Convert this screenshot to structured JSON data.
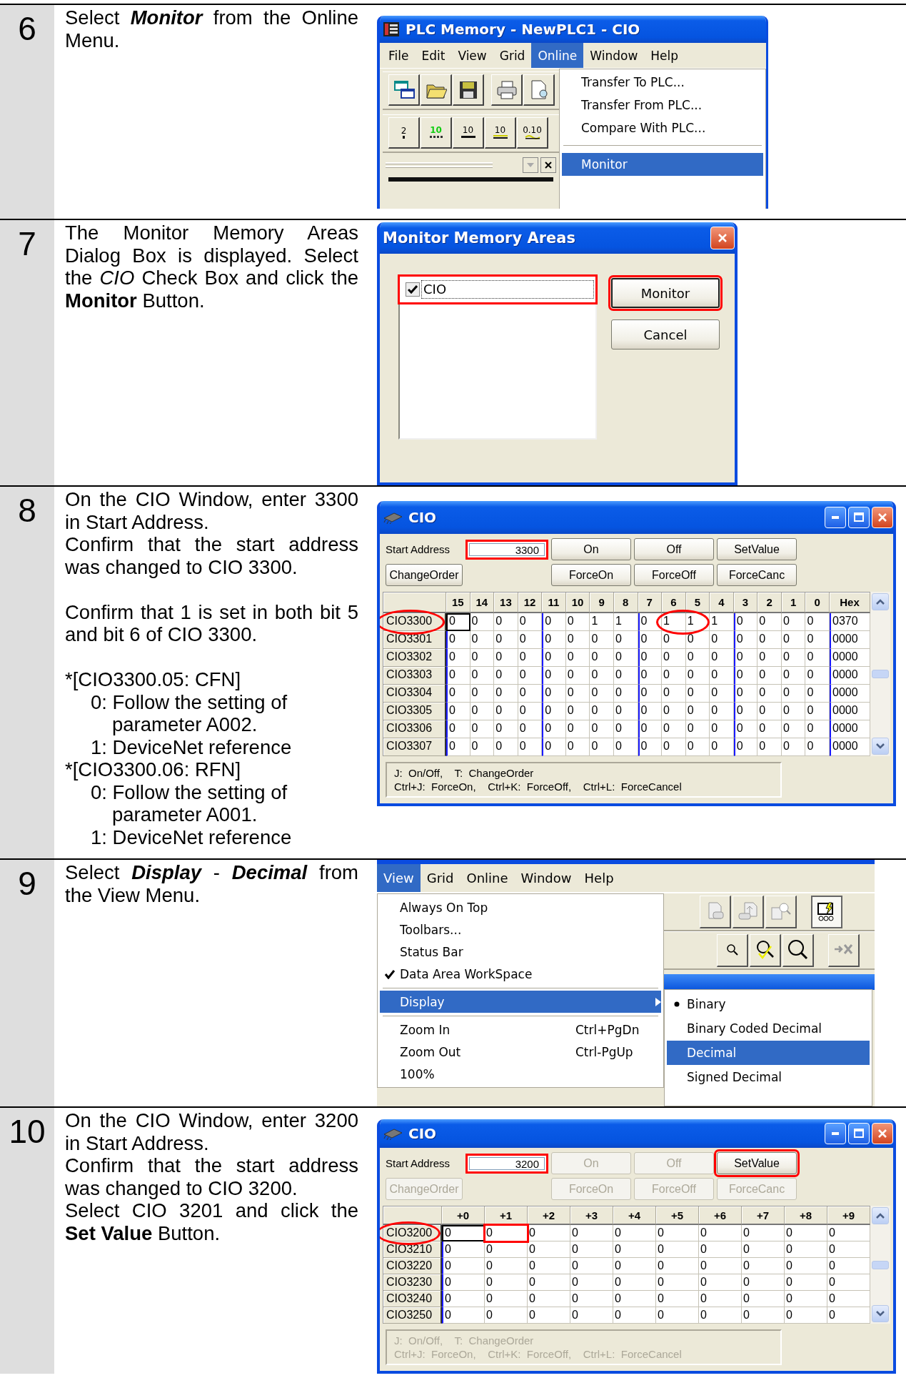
{
  "steps": [
    {
      "number": "6",
      "blocks": [
        {
          "lines": [
            {
              "text": "Select **Monitor** from the Online Menu.",
              "bold_italic": true
            }
          ]
        }
      ],
      "screen": {
        "kind": "menu_window",
        "title": "PLC Memory - NewPLC1 - CIO",
        "menu_bar": [
          {
            "label": "File",
            "selected": false
          },
          {
            "label": "Edit",
            "selected": false
          },
          {
            "label": "View",
            "selected": false
          },
          {
            "label": "Grid",
            "selected": false
          },
          {
            "label": "Online",
            "selected": true
          },
          {
            "label": "Window",
            "selected": false
          },
          {
            "label": "Help",
            "selected": false
          }
        ],
        "toolbar_buttons": [
          {
            "kind": "binary",
            "label": "2"
          },
          {
            "kind": "digital",
            "label": "10"
          },
          {
            "kind": "decimal",
            "label": "10"
          },
          {
            "kind": "signed",
            "label": "10"
          },
          {
            "kind": "float",
            "label": "0.10"
          }
        ],
        "menu": [
          {
            "kind": "item",
            "label": "Transfer To PLC...",
            "selected": false
          },
          {
            "kind": "item",
            "label": "Transfer From PLC...",
            "selected": false
          },
          {
            "kind": "item",
            "label": "Compare With PLC...",
            "selected": false
          },
          {
            "kind": "separator"
          },
          {
            "kind": "item",
            "label": "Monitor",
            "selected": true
          }
        ]
      }
    },
    {
      "number": "7",
      "blocks": [
        {
          "lines": [
            {
              "text": "The Monitor Memory Areas Dialog Box is displayed. Select the *CIO* Check Box and click the **Monitor** Button.",
              "bold_italic": false
            }
          ]
        }
      ],
      "screen": {
        "kind": "dialog",
        "title": "Monitor Memory Areas",
        "list": [
          {
            "label": "CIO",
            "checked": true,
            "highlighted": true
          }
        ],
        "buttons": [
          {
            "label": "Monitor",
            "default": true,
            "highlighted": true
          },
          {
            "label": "Cancel",
            "default": false,
            "highlighted": false
          }
        ]
      }
    },
    {
      "number": "8",
      "blocks": [
        {
          "lines": [
            {
              "text": "On the CIO Window, enter 3300 in Start Address."
            },
            {
              "text": "Confirm that the start address was changed to CIO 3300."
            }
          ]
        },
        {
          "lines": [
            {
              "text": "Confirm that 1 is set in both bit 5 and bit 6 of CIO 3300."
            }
          ]
        },
        {
          "lines": [
            {
              "text": "*[CIO3300.05: CFN]",
              "children": [
                {
                  "text": "0: Follow the setting of parameter A002."
                },
                {
                  "text": "1: DeviceNet reference"
                }
              ]
            },
            {
              "text": "*[CIO3300.06: RFN]",
              "children": [
                {
                  "text": "0: Follow the setting of parameter A001."
                },
                {
                  "text": "1: DeviceNet reference"
                }
              ]
            }
          ]
        }
      ],
      "screen": {
        "kind": "memory_window",
        "title": "CIO",
        "start_address": {
          "label": "Start Address",
          "value": "3300",
          "highlighted": true
        },
        "button_rows": [
          [
            {
              "label": "On",
              "disabled": false,
              "highlighted": false
            },
            {
              "label": "Off",
              "disabled": false,
              "highlighted": false
            },
            {
              "label": "SetValue",
              "disabled": false,
              "highlighted": false
            }
          ],
          [
            {
              "label": "ChangeOrder",
              "disabled": false,
              "highlighted": false
            },
            {
              "label": "ForceOn",
              "disabled": false,
              "highlighted": false
            },
            {
              "label": "ForceOff",
              "disabled": false,
              "highlighted": false
            },
            {
              "label": "ForceCanc",
              "disabled": false,
              "highlighted": false
            }
          ]
        ],
        "grid": {
          "kind": "bits",
          "columns": [
            "15",
            "14",
            "13",
            "12",
            "11",
            "10",
            "9",
            "8",
            "7",
            "6",
            "5",
            "4",
            "3",
            "2",
            "1",
            "0",
            "Hex"
          ],
          "rows": [
            {
              "label": "CIO3300",
              "label_circled": true,
              "cells": [
                {
                  "value": "0",
                  "focused": true,
                  "circled": false
                },
                {
                  "value": "0",
                  "focused": false,
                  "circled": false
                },
                {
                  "value": "0",
                  "focused": false,
                  "circled": false
                },
                {
                  "value": "0",
                  "focused": false,
                  "circled": false
                },
                {
                  "value": "0",
                  "focused": false,
                  "circled": false
                },
                {
                  "value": "0",
                  "focused": false,
                  "circled": false
                },
                {
                  "value": "1",
                  "focused": false,
                  "circled": false
                },
                {
                  "value": "1",
                  "focused": false,
                  "circled": false
                },
                {
                  "value": "0",
                  "focused": false,
                  "circled": false
                },
                {
                  "value": "1",
                  "focused": false,
                  "circled": true
                },
                {
                  "value": "1",
                  "focused": false,
                  "circled": true
                },
                {
                  "value": "1",
                  "focused": false,
                  "circled": false
                },
                {
                  "value": "0",
                  "focused": false,
                  "circled": false
                },
                {
                  "value": "0",
                  "focused": false,
                  "circled": false
                },
                {
                  "value": "0",
                  "focused": false,
                  "circled": false
                },
                {
                  "value": "0",
                  "focused": false,
                  "circled": false
                },
                {
                  "value": "0370",
                  "focused": false,
                  "circled": false
                }
              ]
            },
            {
              "label": "CIO3301",
              "label_circled": false,
              "cells": [
                "0",
                "0",
                "0",
                "0",
                "0",
                "0",
                "0",
                "0",
                "0",
                "0",
                "0",
                "0",
                "0",
                "0",
                "0",
                "0",
                "0000"
              ]
            },
            {
              "label": "CIO3302",
              "label_circled": false,
              "cells": [
                "0",
                "0",
                "0",
                "0",
                "0",
                "0",
                "0",
                "0",
                "0",
                "0",
                "0",
                "0",
                "0",
                "0",
                "0",
                "0",
                "0000"
              ]
            },
            {
              "label": "CIO3303",
              "label_circled": false,
              "cells": [
                "0",
                "0",
                "0",
                "0",
                "0",
                "0",
                "0",
                "0",
                "0",
                "0",
                "0",
                "0",
                "0",
                "0",
                "0",
                "0",
                "0000"
              ]
            },
            {
              "label": "CIO3304",
              "label_circled": false,
              "cells": [
                "0",
                "0",
                "0",
                "0",
                "0",
                "0",
                "0",
                "0",
                "0",
                "0",
                "0",
                "0",
                "0",
                "0",
                "0",
                "0",
                "0000"
              ]
            },
            {
              "label": "CIO3305",
              "label_circled": false,
              "cells": [
                "0",
                "0",
                "0",
                "0",
                "0",
                "0",
                "0",
                "0",
                "0",
                "0",
                "0",
                "0",
                "0",
                "0",
                "0",
                "0",
                "0000"
              ]
            },
            {
              "label": "CIO3306",
              "label_circled": false,
              "cells": [
                "0",
                "0",
                "0",
                "0",
                "0",
                "0",
                "0",
                "0",
                "0",
                "0",
                "0",
                "0",
                "0",
                "0",
                "0",
                "0",
                "0000"
              ]
            },
            {
              "label": "CIO3307",
              "label_circled": false,
              "cells": [
                "0",
                "0",
                "0",
                "0",
                "0",
                "0",
                "0",
                "0",
                "0",
                "0",
                "0",
                "0",
                "0",
                "0",
                "0",
                "0",
                "0000"
              ]
            }
          ]
        },
        "status": {
          "disabled": false,
          "lines": [
            "J:  On/Off,    T:  ChangeOrder",
            "Ctrl+J:  ForceOn,    Ctrl+K:  ForceOff,    Ctrl+L:  ForceCancel"
          ]
        }
      }
    },
    {
      "number": "9",
      "blocks": [
        {
          "lines": [
            {
              "text": "Select **Display** - **Decimal** from the View Menu.",
              "bold_italic": true
            }
          ]
        }
      ],
      "screen": {
        "kind": "menu_popup",
        "menu_bar": [
          {
            "label": "View",
            "selected": true
          },
          {
            "label": "Grid",
            "selected": false
          },
          {
            "label": "Online",
            "selected": false
          },
          {
            "label": "Window",
            "selected": false
          },
          {
            "label": "Help",
            "selected": false
          }
        ],
        "menu": [
          {
            "kind": "item",
            "label": "Always On Top",
            "checked": false,
            "selected": false
          },
          {
            "kind": "item",
            "label": "Toolbars...",
            "checked": false,
            "selected": false
          },
          {
            "kind": "item",
            "label": "Status Bar",
            "checked": false,
            "selected": false
          },
          {
            "kind": "item",
            "label": "Data Area WorkSpace",
            "checked": true,
            "selected": false
          },
          {
            "kind": "separator"
          },
          {
            "kind": "submenu",
            "label": "Display",
            "checked": false,
            "selected": true
          },
          {
            "kind": "separator"
          },
          {
            "kind": "item",
            "label": "Zoom In",
            "shortcut": "Ctrl+PgDn",
            "checked": false,
            "selected": false
          },
          {
            "kind": "item",
            "label": "Zoom Out",
            "shortcut": "Ctrl-PgUp",
            "checked": false,
            "selected": false
          },
          {
            "kind": "item",
            "label": "100%",
            "checked": false,
            "selected": false
          }
        ],
        "submenu": [
          {
            "label": "Binary",
            "checked": true,
            "selected": false
          },
          {
            "label": "Binary Coded Decimal",
            "checked": false,
            "selected": false
          },
          {
            "label": "Decimal",
            "checked": false,
            "selected": true
          },
          {
            "label": "Signed Decimal",
            "checked": false,
            "selected": false
          }
        ]
      }
    },
    {
      "number": "10",
      "blocks": [
        {
          "lines": [
            {
              "text": "On the CIO Window, enter 3200 in Start Address."
            },
            {
              "text": "Confirm that the start address was changed to CIO 3200."
            },
            {
              "text": "Select CIO 3201 and click the **Set Value** Button.",
              "bold_italic": false
            }
          ]
        }
      ],
      "screen": {
        "kind": "memory_window",
        "title": "CIO",
        "start_address": {
          "label": "Start Address",
          "value": "3200",
          "highlighted": true
        },
        "button_rows": [
          [
            {
              "label": "On",
              "disabled": true,
              "highlighted": false
            },
            {
              "label": "Off",
              "disabled": true,
              "highlighted": false
            },
            {
              "label": "SetValue",
              "disabled": false,
              "highlighted": true
            }
          ],
          [
            {
              "label": "ChangeOrder",
              "disabled": true,
              "highlighted": false
            },
            {
              "label": "ForceOn",
              "disabled": true,
              "highlighted": false
            },
            {
              "label": "ForceOff",
              "disabled": true,
              "highlighted": false
            },
            {
              "label": "ForceCanc",
              "disabled": true,
              "highlighted": false
            }
          ]
        ],
        "grid": {
          "kind": "words",
          "columns": [
            "+0",
            "+1",
            "+2",
            "+3",
            "+4",
            "+5",
            "+6",
            "+7",
            "+8",
            "+9"
          ],
          "rows": [
            {
              "label": "CIO3200",
              "label_circled": true,
              "cells": [
                {
                  "value": "0",
                  "focused": true,
                  "highlighted": false
                },
                {
                  "value": "0",
                  "focused": false,
                  "highlighted": true
                },
                {
                  "value": "0",
                  "focused": false,
                  "highlighted": false
                },
                {
                  "value": "0",
                  "focused": false,
                  "highlighted": false
                },
                {
                  "value": "0",
                  "focused": false,
                  "highlighted": false
                },
                {
                  "value": "0",
                  "focused": false,
                  "highlighted": false
                },
                {
                  "value": "0",
                  "focused": false,
                  "highlighted": false
                },
                {
                  "value": "0",
                  "focused": false,
                  "highlighted": false
                },
                {
                  "value": "0",
                  "focused": false,
                  "highlighted": false
                },
                {
                  "value": "0",
                  "focused": false,
                  "highlighted": false
                }
              ]
            },
            {
              "label": "CIO3210",
              "label_circled": false,
              "cells": [
                "0",
                "0",
                "0",
                "0",
                "0",
                "0",
                "0",
                "0",
                "0",
                "0"
              ]
            },
            {
              "label": "CIO3220",
              "label_circled": false,
              "cells": [
                "0",
                "0",
                "0",
                "0",
                "0",
                "0",
                "0",
                "0",
                "0",
                "0"
              ]
            },
            {
              "label": "CIO3230",
              "label_circled": false,
              "cells": [
                "0",
                "0",
                "0",
                "0",
                "0",
                "0",
                "0",
                "0",
                "0",
                "0"
              ]
            },
            {
              "label": "CIO3240",
              "label_circled": false,
              "cells": [
                "0",
                "0",
                "0",
                "0",
                "0",
                "0",
                "0",
                "0",
                "0",
                "0"
              ]
            },
            {
              "label": "CIO3250",
              "label_circled": false,
              "cells": [
                "0",
                "0",
                "0",
                "0",
                "0",
                "0",
                "0",
                "0",
                "0",
                "0"
              ]
            }
          ]
        },
        "status": {
          "disabled": true,
          "lines": [
            "J:  On/Off,    T:  ChangeOrder",
            "Ctrl+J:  ForceOn,    Ctrl+K:  ForceOff,    Ctrl+L:  ForceCancel"
          ]
        }
      }
    }
  ]
}
